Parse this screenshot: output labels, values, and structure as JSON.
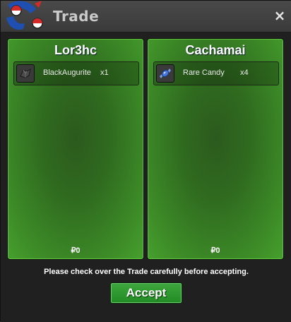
{
  "window": {
    "title": "Trade",
    "close_label": "×"
  },
  "colors": {
    "panel_green": "#3e8e28",
    "accept_green": "#2f9a31",
    "titlebar": "#3f3f3f"
  },
  "trade": {
    "left": {
      "player": "Lor3hc",
      "item": {
        "icon": "black-augurite-icon",
        "name": "BlackAugurite",
        "qty": "x1"
      },
      "money": "₽0"
    },
    "right": {
      "player": "Cachamai",
      "item": {
        "icon": "rare-candy-icon",
        "name": "Rare Candy",
        "qty": "x4"
      },
      "money": "₽0"
    }
  },
  "notice": "Please check over the Trade carefully before accepting.",
  "accept_label": "Accept"
}
